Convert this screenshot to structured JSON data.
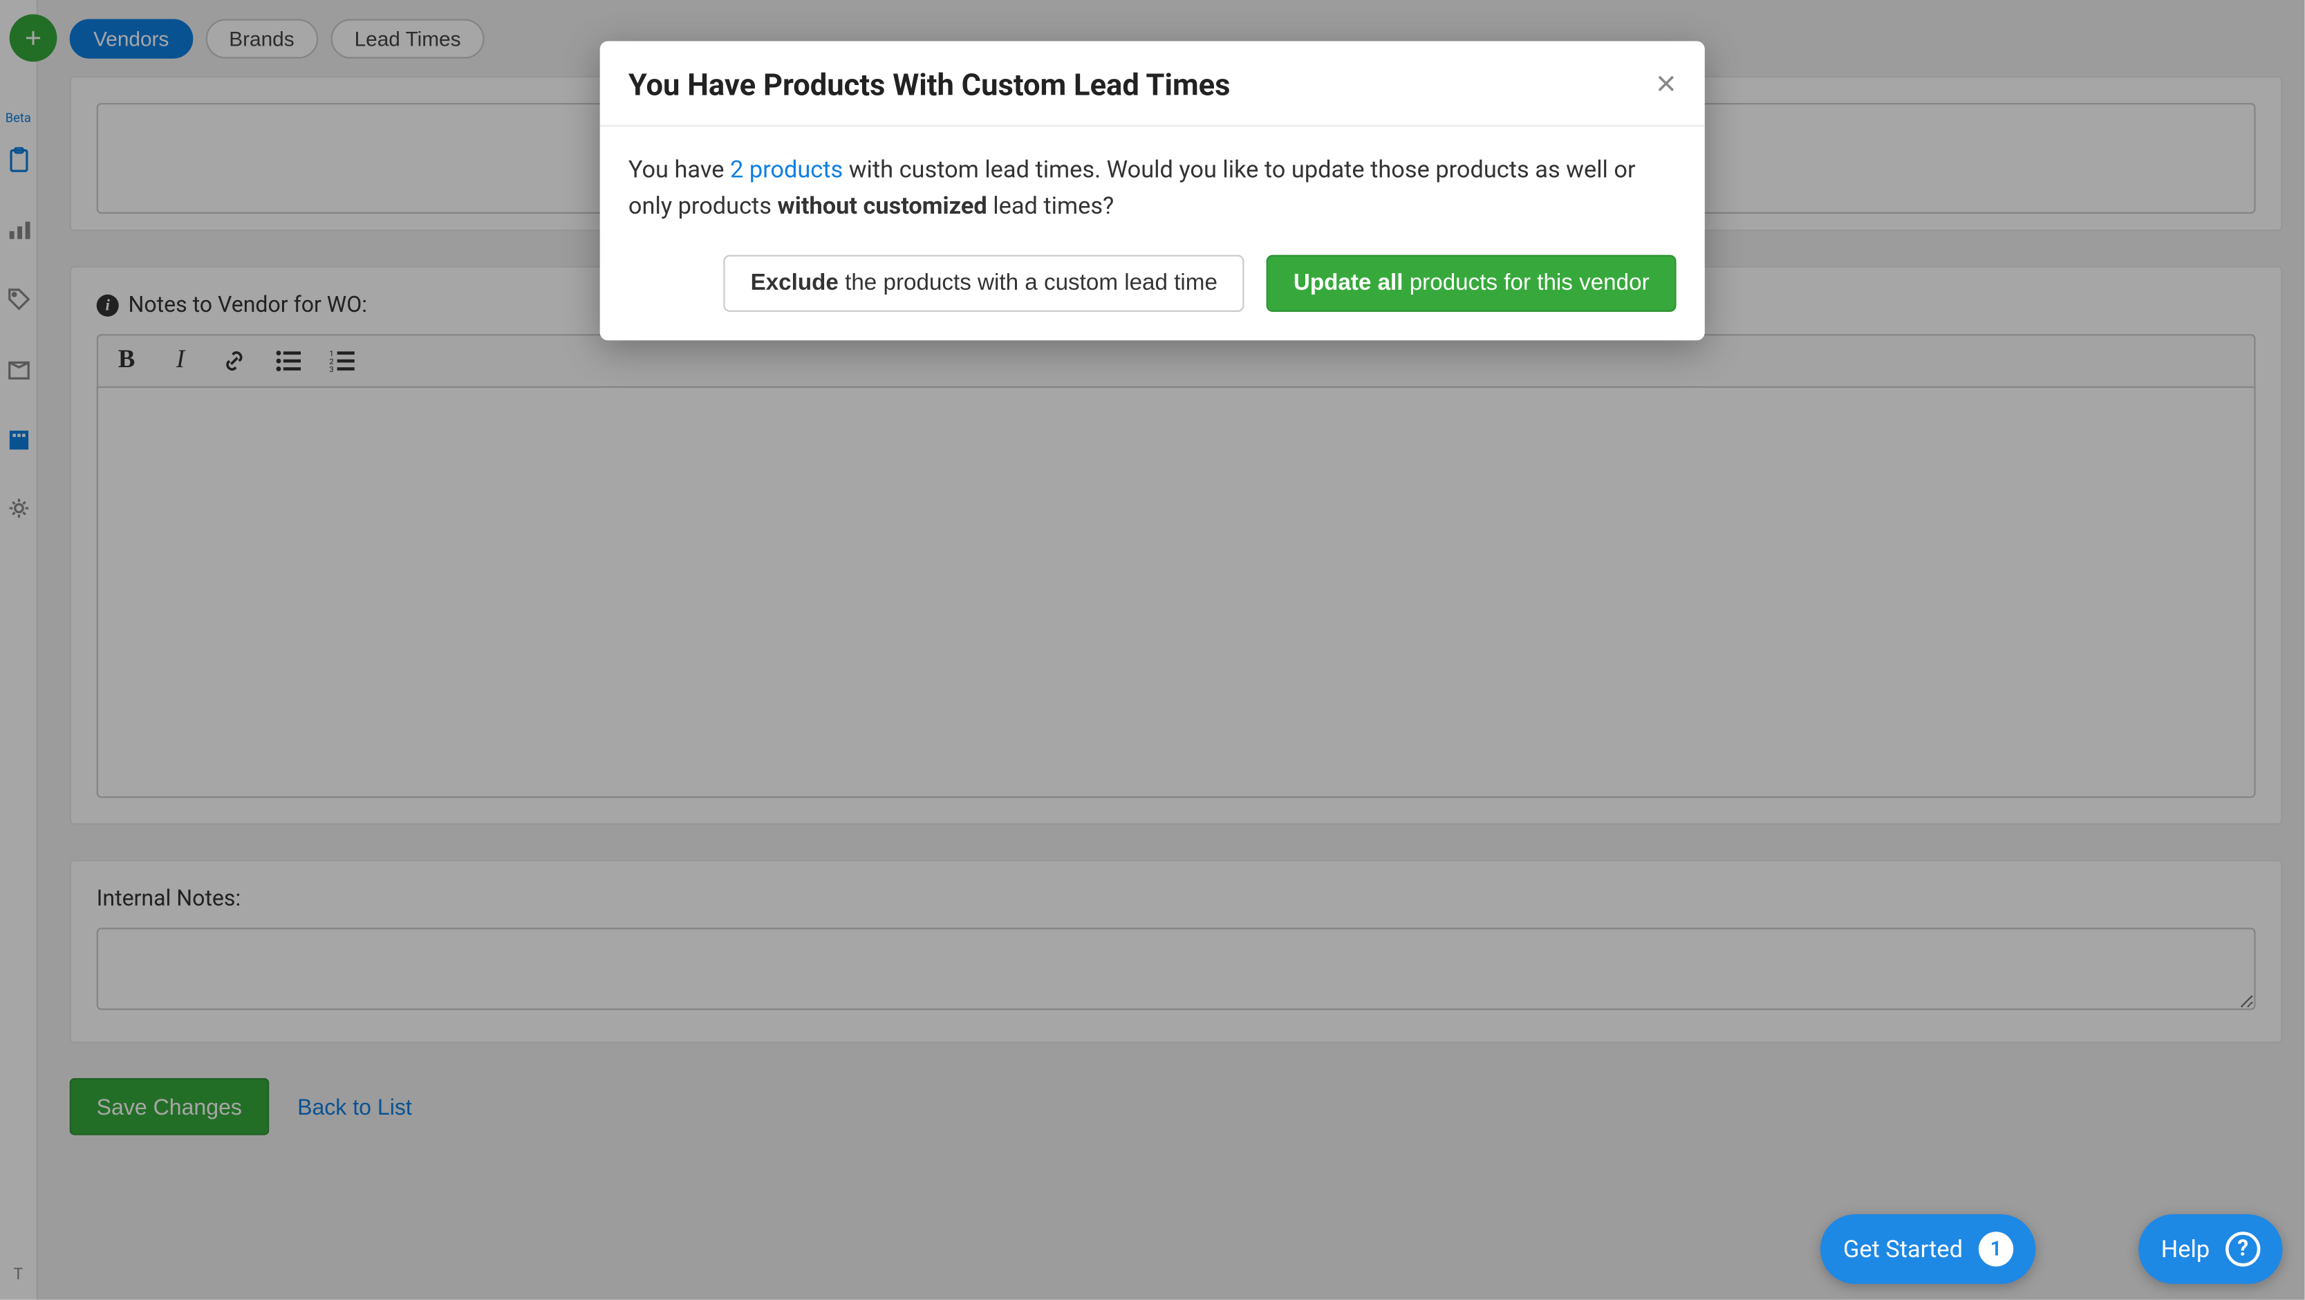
{
  "nav": {
    "tabs": [
      {
        "label": "Vendors",
        "active": true
      },
      {
        "label": "Brands",
        "active": false
      },
      {
        "label": "Lead Times",
        "active": false
      }
    ]
  },
  "leftRail": {
    "betaLabel": "Beta",
    "bottomLabel": "T"
  },
  "panels": {
    "notesLabel": "Notes to Vendor for WO:",
    "internalNotesLabel": "Internal Notes:"
  },
  "toolbar": {
    "bold": "B",
    "italic": "I"
  },
  "actions": {
    "save": "Save Changes",
    "back": "Back to List"
  },
  "floaters": {
    "getStarted": "Get Started",
    "getStartedBadge": "1",
    "help": "Help",
    "helpIcon": "?"
  },
  "modal": {
    "title": "You Have Products With Custom Lead Times",
    "body": {
      "prefix": "You have ",
      "linkText": "2 products",
      "mid": " with custom lead times. Would you like to update those products as well or only products ",
      "boldText": "without customized",
      "suffix": " lead times?"
    },
    "buttons": {
      "exclude": {
        "bold": "Exclude",
        "rest": " the products with a custom lead time"
      },
      "updateAll": {
        "bold": "Update all",
        "rest": " products for this vendor"
      }
    },
    "closeGlyph": "×"
  },
  "icons": {
    "plus": "+",
    "info": "i"
  }
}
